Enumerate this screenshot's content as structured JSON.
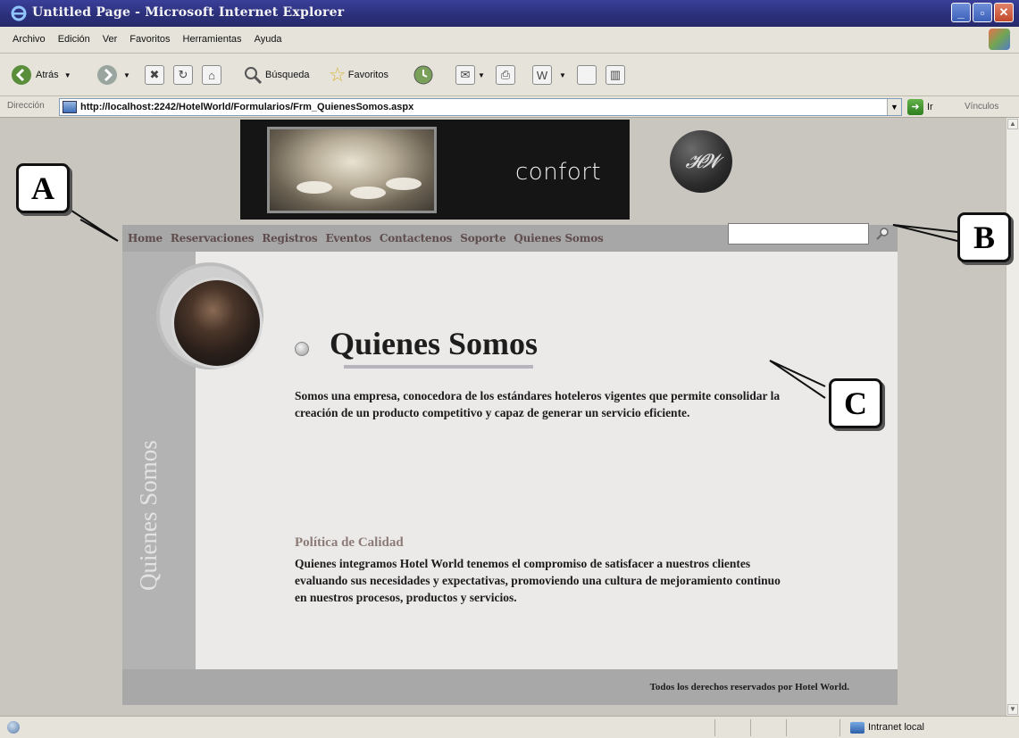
{
  "window": {
    "title": "Untitled Page - Microsoft Internet Explorer",
    "min_glyph": "_",
    "max_glyph": "▫",
    "close_glyph": "✕"
  },
  "menu": [
    "Archivo",
    "Edición",
    "Ver",
    "Favoritos",
    "Herramientas",
    "Ayuda"
  ],
  "toolbar": {
    "back": "Atrás",
    "search": "Búsqueda",
    "favorites": "Favoritos"
  },
  "address": {
    "label": "Dirección",
    "url": "http://localhost:2242/HotelWorld/Formularios/Frm_QuienesSomos.aspx",
    "go": "Ir",
    "links": "Vínculos"
  },
  "site": {
    "banner_word": "confort",
    "logo_text": "HW",
    "nav": [
      "Home",
      "Reservaciones",
      "Registros",
      "Eventos",
      "Contactenos",
      "Soporte",
      "Quienes Somos"
    ],
    "sidebar_text": "Quienes Somos",
    "heading": "Quienes Somos",
    "intro": "Somos una empresa, conocedora de los estándares hoteleros vigentes que permite consolidar la creación de un producto competitivo y capaz de generar un servicio eficiente.",
    "quality_title": "Política de Calidad",
    "quality_text": "Quienes integramos Hotel World tenemos el compromiso de satisfacer a nuestros clientes evaluando sus necesidades y expectativas, promoviendo una cultura de mejoramiento continuo en nuestros procesos, productos y servicios.",
    "footer": "Todos los derechos reservados por Hotel World."
  },
  "callouts": {
    "a": "A",
    "b": "B",
    "c": "C"
  },
  "status": {
    "zone": "Intranet local"
  }
}
